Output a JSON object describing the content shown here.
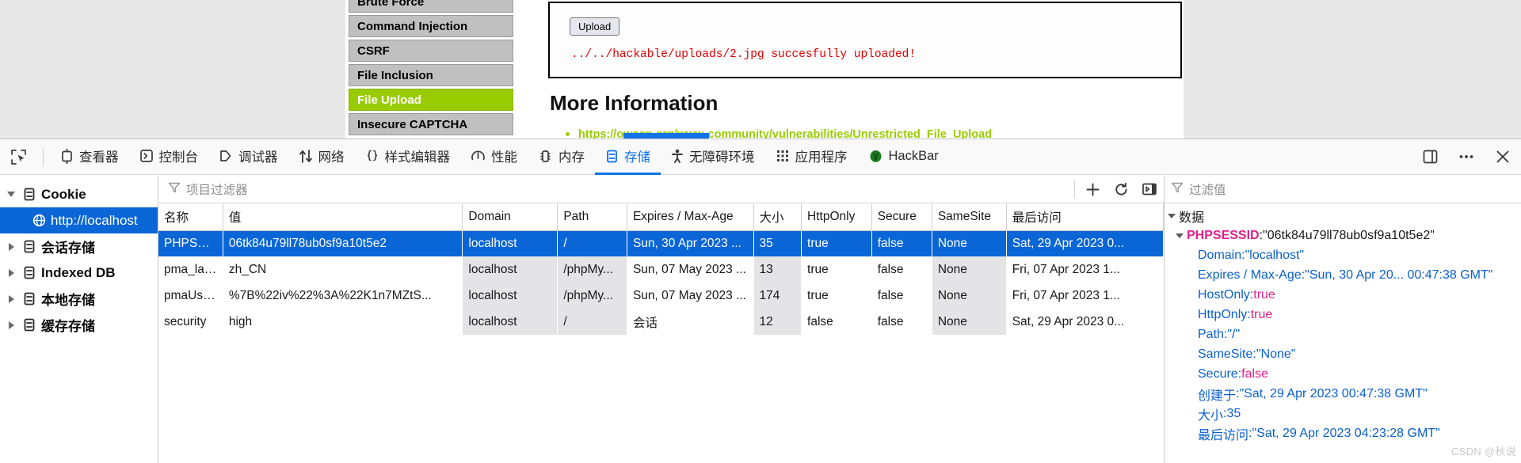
{
  "webpage": {
    "menu_items": [
      {
        "label": "Brute Force",
        "active": false
      },
      {
        "label": "Command Injection",
        "active": false
      },
      {
        "label": "CSRF",
        "active": false
      },
      {
        "label": "File Inclusion",
        "active": false
      },
      {
        "label": "File Upload",
        "active": true
      },
      {
        "label": "Insecure CAPTCHA",
        "active": false
      }
    ],
    "upload_button": "Upload",
    "upload_message": "../../hackable/uploads/2.jpg succesfully uploaded!",
    "more_information_heading": "More Information",
    "more_information_link": "https://owasp.org/www-community/vulnerabilities/Unrestricted_File_Upload",
    "accent_green": "#99cc00",
    "error_red": "#e00000"
  },
  "devtools": {
    "picker_icon": "element-picker-icon",
    "tabs": [
      {
        "label": "查看器",
        "icon": "inspector-icon",
        "selected": false
      },
      {
        "label": "控制台",
        "icon": "console-icon",
        "selected": false
      },
      {
        "label": "调试器",
        "icon": "debugger-icon",
        "selected": false
      },
      {
        "label": "网络",
        "icon": "network-arrows-icon",
        "selected": false
      },
      {
        "label": "样式编辑器",
        "icon": "style-editor-braces-icon",
        "selected": false
      },
      {
        "label": "性能",
        "icon": "performance-gauge-icon",
        "selected": false
      },
      {
        "label": "内存",
        "icon": "memory-chip-icon",
        "selected": false
      },
      {
        "label": "存储",
        "icon": "storage-icon",
        "selected": true
      },
      {
        "label": "无障碍环境",
        "icon": "accessibility-person-icon",
        "selected": false
      },
      {
        "label": "应用程序",
        "icon": "application-grid-icon",
        "selected": false
      },
      {
        "label": "HackBar",
        "icon": "hackbar-icon",
        "selected": false
      }
    ],
    "right_buttons": [
      {
        "icon": "dock-split-icon",
        "name": "dock-toggle-button"
      },
      {
        "icon": "meatball-menu-icon",
        "name": "devtools-settings-menu-button"
      },
      {
        "icon": "close-icon",
        "name": "close-devtools-button"
      }
    ],
    "selected_tab_color": "#0a72e8"
  },
  "sidebar": {
    "items": [
      {
        "label": "Cookie",
        "icon": "storage-icon",
        "twisty": "open",
        "depth": 0,
        "selected": false
      },
      {
        "label": "http://localhost",
        "icon": "globe-icon",
        "twisty": "none",
        "depth": 1,
        "selected": true
      },
      {
        "label": "会话存储",
        "icon": "storage-icon",
        "twisty": "closed",
        "depth": 0,
        "selected": false
      },
      {
        "label": "Indexed DB",
        "icon": "storage-icon",
        "twisty": "closed",
        "depth": 0,
        "selected": false
      },
      {
        "label": "本地存储",
        "icon": "storage-icon",
        "twisty": "closed",
        "depth": 0,
        "selected": false
      },
      {
        "label": "缓存存储",
        "icon": "storage-icon",
        "twisty": "closed",
        "depth": 0,
        "selected": false
      }
    ]
  },
  "item_filter": {
    "placeholder": "项目过滤器",
    "icon": "filter-funnel-icon",
    "buttons": [
      {
        "icon": "plus-icon",
        "name": "add-item-button"
      },
      {
        "icon": "refresh-icon",
        "name": "refresh-items-button"
      },
      {
        "icon": "sidebar-toggle-icon",
        "name": "toggle-sidebar-button"
      }
    ]
  },
  "table": {
    "columns": [
      "名称",
      "值",
      "Domain",
      "Path",
      "Expires / Max-Age",
      "大小",
      "HttpOnly",
      "Secure",
      "SameSite",
      "最后访问"
    ],
    "rows": [
      {
        "selected": true,
        "cells": [
          "PHPSESS...",
          "06tk84u79ll78ub0sf9a10t5e2",
          "localhost",
          "/",
          "Sun, 30 Apr 2023 ...",
          "35",
          "true",
          "false",
          "None",
          "Sat, 29 Apr 2023 0..."
        ]
      },
      {
        "selected": false,
        "cells": [
          "pma_lang",
          "zh_CN",
          "localhost",
          "/phpMy...",
          "Sun, 07 May 2023 ...",
          "13",
          "true",
          "false",
          "None",
          "Fri, 07 Apr 2023 1..."
        ]
      },
      {
        "selected": false,
        "cells": [
          "pmaUser...",
          "%7B%22iv%22%3A%22K1n7MZtS...",
          "localhost",
          "/phpMy...",
          "Sun, 07 May 2023 ...",
          "174",
          "true",
          "false",
          "None",
          "Fri, 07 Apr 2023 1..."
        ]
      },
      {
        "selected": false,
        "cells": [
          "security",
          "high",
          "localhost",
          "/",
          "会话",
          "12",
          "false",
          "false",
          "None",
          "Sat, 29 Apr 2023 0..."
        ]
      }
    ]
  },
  "detail": {
    "filter_placeholder": "过滤值",
    "filter_icon": "filter-funnel-icon",
    "root_label": "数据",
    "cookie_key": "PHPSESSID",
    "cookie_value": "\"06tk84u79ll78ub0sf9a10t5e2\"",
    "properties": [
      {
        "key": "Domain",
        "value": "\"localhost\"",
        "value_kind": "string"
      },
      {
        "key": "Expires / Max-Age",
        "value": "\"Sun, 30 Apr 20... 00:47:38 GMT\"",
        "value_kind": "string"
      },
      {
        "key": "HostOnly",
        "value": "true",
        "value_kind": "bool"
      },
      {
        "key": "HttpOnly",
        "value": "true",
        "value_kind": "bool"
      },
      {
        "key": "Path",
        "value": "\"/\"",
        "value_kind": "string"
      },
      {
        "key": "SameSite",
        "value": "\"None\"",
        "value_kind": "string"
      },
      {
        "key": "Secure",
        "value": "false",
        "value_kind": "bool"
      },
      {
        "key": "创建于",
        "value": "\"Sat, 29 Apr 2023 00:47:38 GMT\"",
        "value_kind": "string"
      },
      {
        "key": "大小",
        "value": "35",
        "value_kind": "number"
      },
      {
        "key": "最后访问",
        "value": "\"Sat, 29 Apr 2023 04:23:28 GMT\"",
        "value_kind": "string"
      }
    ],
    "key_color": "#0a5fce",
    "bool_color": "#e0218a"
  },
  "watermark": "CSDN @秋说"
}
